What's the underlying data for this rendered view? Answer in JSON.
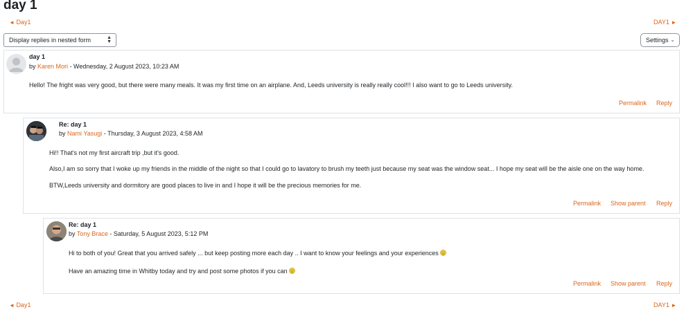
{
  "page": {
    "title": "day 1"
  },
  "nav": {
    "prev_label": "Day1",
    "next_label": "DAY1",
    "prev_arrow": "◄",
    "next_arrow": "►"
  },
  "controls": {
    "display_mode": "Display replies in nested form",
    "settings_label": "Settings"
  },
  "posts": [
    {
      "subject": "day 1",
      "by": "by",
      "author": "Karen Mori",
      "date": "- Wednesday, 2 August 2023, 10:23 AM",
      "paragraphs": [
        "Hello! The fright was very good, but there were many meals. It was my first time on an airplane. And, Leeds university is really really cool!!! I also want to go to Leeds university."
      ],
      "actions": [
        "Permalink",
        "Reply"
      ]
    },
    {
      "subject": "Re: day 1",
      "by": "by",
      "author": "Nami Yasugi",
      "date": "- Thursday, 3 August 2023, 4:58 AM",
      "paragraphs": [
        "Hi!!  That's not my first aircraft trip ,but it's good.",
        "Also,I am so sorry that I woke up my friends in the middle of the night so that I could go to lavatory to brush my teeth just because my seat was the window seat...  I hope my seat will be the aisle one on the way home.",
        "BTW,Leeds university and dormitory are good places to live in and I hope it will be the precious memories for me."
      ],
      "actions": [
        "Permalink",
        "Show parent",
        "Reply"
      ]
    },
    {
      "subject": "Re: day 1",
      "by": "by",
      "author": "Tony Brace",
      "date": "- Saturday, 5 August 2023, 5:12 PM",
      "paragraphs": [
        "Hi to both of you! Great that you arrived safely ... but keep posting more each day .. I want to know your feelings and your experiences",
        "Have an amazing time in Whitby today and try and post some photos if you can"
      ],
      "actions": [
        "Permalink",
        "Show parent",
        "Reply"
      ]
    }
  ],
  "colors": {
    "link": "#d9661a",
    "border": "#dee2e6",
    "text": "#1d2125"
  },
  "icons": {
    "smiley": "smiley-emoticon-icon",
    "select_caret": "up-down-caret-icon",
    "settings_chevron": "chevron-down-icon"
  }
}
